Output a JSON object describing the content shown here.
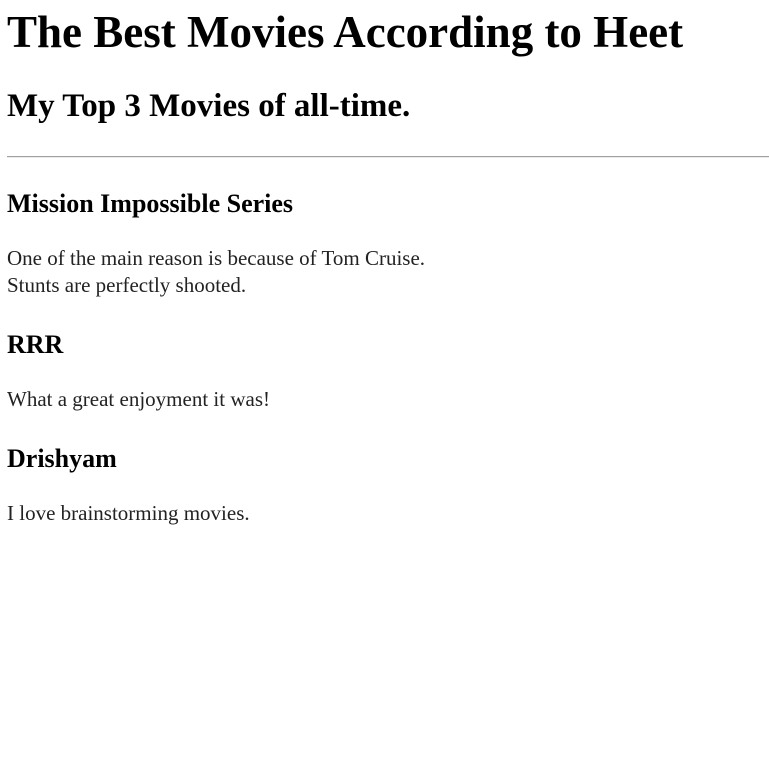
{
  "page": {
    "title": "The Best Movies According to Heet",
    "subtitle": "My Top 3 Movies of all-time."
  },
  "movies": [
    {
      "name": "Mission Impossible Series",
      "lines": [
        "One of the main reason is because of Tom Cruise.",
        "Stunts are perfectly shooted."
      ]
    },
    {
      "name": "RRR",
      "lines": [
        "What a great enjoyment it was!"
      ]
    },
    {
      "name": "Drishyam",
      "lines": [
        "I love brainstorming movies."
      ]
    }
  ]
}
